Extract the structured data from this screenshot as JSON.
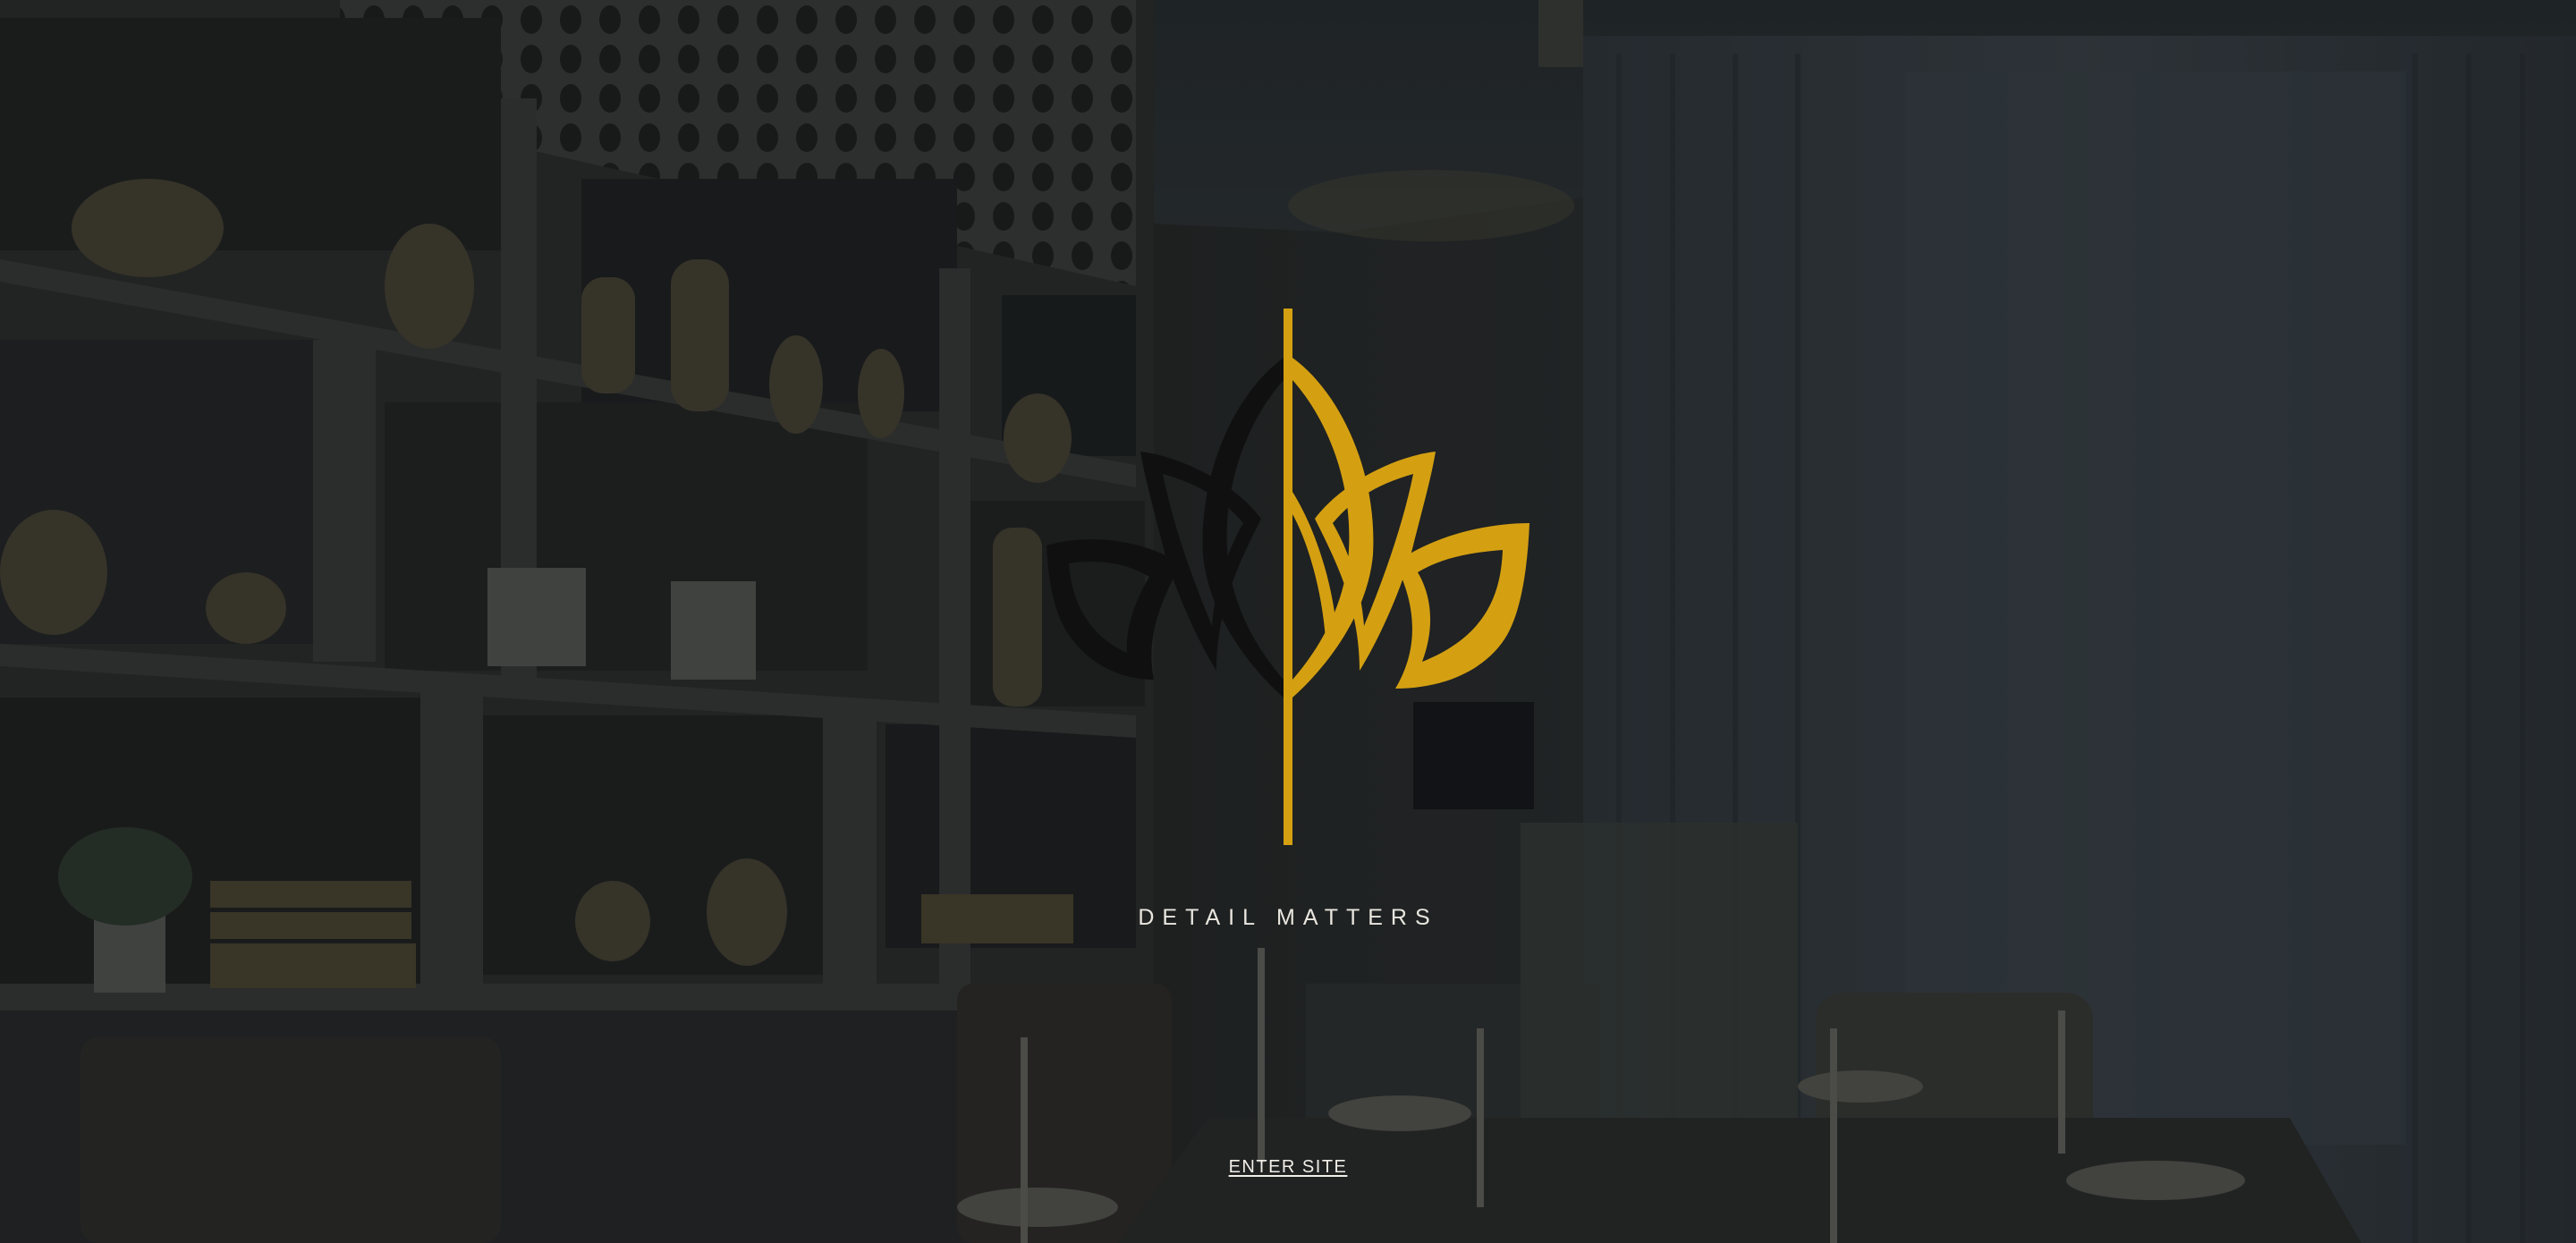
{
  "landing": {
    "tagline": "DETAIL MATTERS",
    "enter_label": "ENTER SITE"
  },
  "background": {
    "scene": "dark-dining-room-photo"
  },
  "logo": {
    "icon": "lotus-logo-icon",
    "colors": {
      "gold": "#d4a012",
      "dark": "#101010"
    }
  }
}
